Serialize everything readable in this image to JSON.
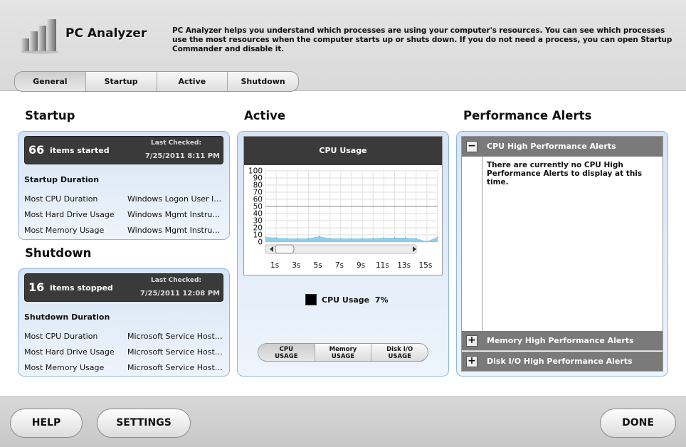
{
  "app": {
    "title": "PC Analyzer",
    "description": "PC Analyzer helps you understand which processes are using your computer's resources.  You can see which processes use the most resources when the computer starts up or shuts down.  If you do not need a process, you can open Startup Commander and disable it."
  },
  "tabs": [
    {
      "label": "General",
      "active": true
    },
    {
      "label": "Startup"
    },
    {
      "label": "Active"
    },
    {
      "label": "Shutdown"
    }
  ],
  "startup": {
    "title": "Startup",
    "count": "66",
    "count_label": "items started",
    "last_checked_label": "Last Checked:",
    "last_checked": "7/25/2011 8:11 PM",
    "duration_title": "Startup Duration",
    "rows": [
      {
        "label": "Most CPU Duration",
        "value": "Windows Logon User Interface Host"
      },
      {
        "label": "Most Hard Drive Usage",
        "value": "Windows Mgmt Instrumentation"
      },
      {
        "label": "Most Memory Usage",
        "value": "Windows Mgmt Instrumentation"
      }
    ]
  },
  "shutdown": {
    "title": "Shutdown",
    "count": "16",
    "count_label": "items stopped",
    "last_checked_label": "Last Checked:",
    "last_checked": "7/25/2011 12:08 PM",
    "duration_title": "Shutdown Duration",
    "rows": [
      {
        "label": "Most CPU Duration",
        "value": "Microsoft Service Host Process"
      },
      {
        "label": "Most Hard Drive Usage",
        "value": "Microsoft Service Host Process"
      },
      {
        "label": "Most Memory Usage",
        "value": "Microsoft Service Host Process"
      }
    ]
  },
  "active": {
    "title": "Active",
    "chart_title": "CPU Usage",
    "legend_label": "CPU Usage",
    "legend_value": "7%",
    "buttons": [
      {
        "line1": "CPU",
        "line2": "USAGE",
        "active": true
      },
      {
        "line1": "Memory",
        "line2": "USAGE"
      },
      {
        "line1": "Disk I/O",
        "line2": "USAGE"
      }
    ]
  },
  "chart_data": {
    "type": "area",
    "title": "CPU Usage",
    "y_ticks": [
      "100",
      "90",
      "80",
      "70",
      "60",
      "50",
      "40",
      "30",
      "20",
      "10",
      "0"
    ],
    "x_ticks": [
      "1s",
      "3s",
      "5s",
      "7s",
      "9s",
      "11s",
      "13s",
      "15s"
    ],
    "ylim": [
      0,
      100
    ],
    "x": [
      0,
      1,
      2,
      3,
      4,
      5,
      6,
      7,
      8,
      9,
      10,
      11,
      12,
      13,
      14,
      15,
      16
    ],
    "values": [
      7,
      6,
      5,
      5,
      5,
      8,
      5,
      5,
      5,
      5,
      5,
      6,
      6,
      6,
      5,
      1,
      7
    ],
    "color": "#7fc4ea"
  },
  "alerts": {
    "title": "Performance Alerts",
    "cpu_title": "CPU High Performance Alerts",
    "cpu_message": "There are currently no CPU High Performance Alerts to display at this time.",
    "memory_title": "Memory High Performance Alerts",
    "disk_title": "Disk I/O High Performance Alerts",
    "minus_symbol": "−",
    "plus_symbol": "+"
  },
  "footer": {
    "help": "HELP",
    "settings": "SETTINGS",
    "done": "DONE"
  }
}
